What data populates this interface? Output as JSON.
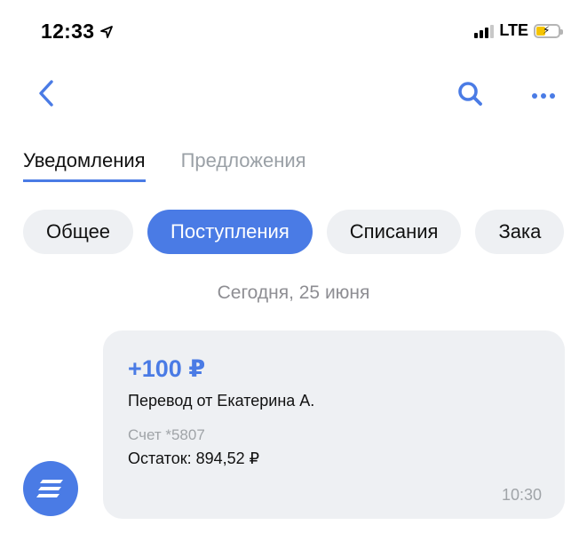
{
  "status": {
    "time": "12:33",
    "network": "LTE"
  },
  "tabs": [
    {
      "label": "Уведомления",
      "active": true
    },
    {
      "label": "Предложения",
      "active": false
    }
  ],
  "chips": [
    {
      "label": "Общее",
      "active": false
    },
    {
      "label": "Поступления",
      "active": true
    },
    {
      "label": "Списания",
      "active": false
    },
    {
      "label": "Зака",
      "active": false
    }
  ],
  "feed": {
    "date": "Сегодня, 25 июня",
    "item": {
      "amount": "+100 ₽",
      "description": "Перевод от Екатерина А.",
      "account": "Счет *5807",
      "balance": "Остаток: 894,52 ₽",
      "time": "10:30"
    }
  },
  "colors": {
    "accent": "#4a7be5",
    "chip_bg": "#eef0f3",
    "muted_text": "#8e8e93"
  },
  "icons": {
    "back": "chevron-left-icon",
    "search": "search-icon",
    "more": "ellipsis-icon",
    "avatar": "stacked-lines-logo-icon",
    "location": "location-arrow-icon"
  }
}
